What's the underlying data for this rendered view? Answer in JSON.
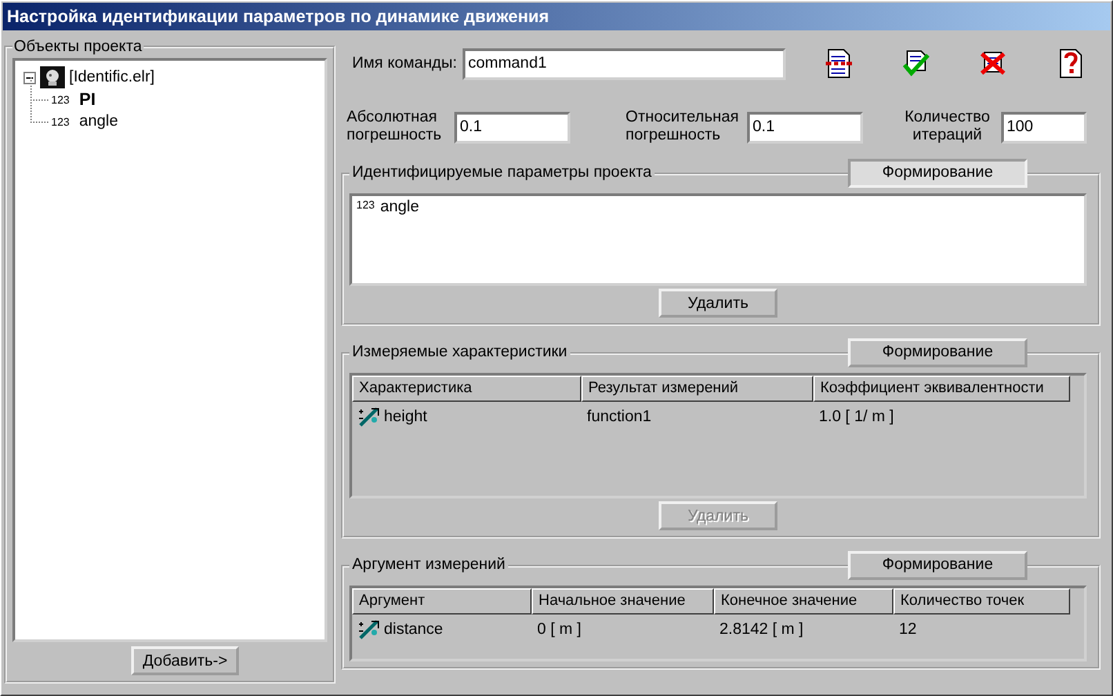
{
  "window": {
    "title": "Настройка идентификации параметров по динамике движения"
  },
  "project_objects": {
    "title": "Объекты проекта",
    "tree": [
      {
        "label": "[Identific.elr]",
        "expanded": true,
        "children": [
          {
            "badge": "123",
            "label": "PI",
            "bold": true
          },
          {
            "badge": "123",
            "label": "angle",
            "bold": false
          }
        ]
      }
    ],
    "add_button": "Добавить->"
  },
  "command": {
    "label": "Имя команды:",
    "value": "command1"
  },
  "params": [
    {
      "label": "Абсолютная погрешность",
      "value": "0.1"
    },
    {
      "label": "Относительная погрешность",
      "value": "0.1"
    },
    {
      "label": "Количество итераций",
      "value": "100"
    }
  ],
  "groups": [
    {
      "kind": "list",
      "title": "Идентифицируемые параметры проекта",
      "form_button": {
        "label": "Формирование",
        "pressed": true
      },
      "items": [
        {
          "badge": "123",
          "label": "angle"
        }
      ],
      "delete_button": {
        "label": "Удалить",
        "disabled": false
      }
    },
    {
      "kind": "table",
      "title": "Измеряемые характеристики",
      "form_button": {
        "label": "Формирование",
        "pressed": false
      },
      "table": {
        "columns": [
          "Характеристика",
          "Результат измерений",
          "Коэффициент эквивалентности"
        ],
        "rows": [
          [
            "height",
            "function1",
            "1.0  [ 1/ m ]"
          ]
        ]
      },
      "delete_button": {
        "label": "Удалить",
        "disabled": true
      }
    },
    {
      "kind": "table",
      "title": "Аргумент измерений",
      "form_button": {
        "label": "Формирование",
        "pressed": false
      },
      "table": {
        "columns": [
          "Аргумент",
          "Начальное значение",
          "Конечное значение",
          "Количество точек"
        ],
        "rows": [
          [
            "distance",
            "0 [ m ]",
            "2.8142 [ m ]",
            "12"
          ]
        ]
      }
    }
  ]
}
